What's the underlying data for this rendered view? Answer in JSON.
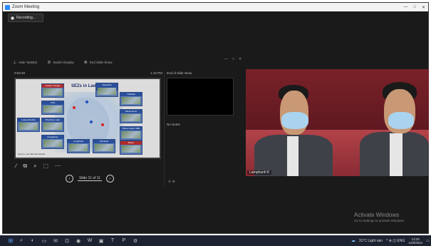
{
  "window": {
    "title": "Zoom Meeting",
    "controls": [
      "—",
      "□",
      "✕"
    ]
  },
  "recording": {
    "label": "Recording..."
  },
  "share_toolbar": {
    "items": [
      {
        "icon": "hide-taskbar-icon",
        "glyph": "⊥",
        "label": "Hide Taskbar"
      },
      {
        "icon": "switch-display-icon",
        "glyph": "⊘",
        "label": "Switch Display"
      },
      {
        "icon": "end-show-icon",
        "glyph": "⊗",
        "label": "End Slide Show"
      }
    ],
    "panel_controls": [
      "—",
      "□",
      "✕"
    ]
  },
  "viewer": {
    "time": "0:53:29",
    "slide_count": "1:10 PM"
  },
  "slide": {
    "title": "SEZs in Lao PDR",
    "boxes": [
      {
        "label": "Golden Triangle",
        "color": "red"
      },
      {
        "label": "Saysettha Development",
        "color": "blue"
      },
      {
        "label": "VITA",
        "color": "blue"
      },
      {
        "label": "Thakhek",
        "color": "blue"
      },
      {
        "label": "Phoukhyo Lake",
        "color": "blue"
      },
      {
        "label": "Dongphosy",
        "color": "blue"
      },
      {
        "label": "Savan-Seno",
        "color": "blue"
      },
      {
        "label": "Longthanh",
        "color": "blue"
      },
      {
        "label": "Vientiane",
        "color": "blue"
      },
      {
        "label": "Pakse-Japan SME",
        "color": "blue"
      },
      {
        "label": "Boten",
        "color": "red"
      },
      {
        "label": "Luang Namtha",
        "color": "blue"
      }
    ],
    "footer": "Source: Lao SEZ Secretariat"
  },
  "slide_tools": [
    {
      "icon": "pen-icon",
      "glyph": "∕"
    },
    {
      "icon": "slides-icon",
      "glyph": "⧉"
    },
    {
      "icon": "magnifier-icon",
      "glyph": "⌕"
    },
    {
      "icon": "subtitles-icon",
      "glyph": "⬚"
    },
    {
      "icon": "more-options-icon",
      "glyph": "⋯"
    }
  ],
  "pager": {
    "label": "Slide 11 of 11",
    "prev_glyph": "‹",
    "next_glyph": "›"
  },
  "notes": {
    "header": "End of slide show",
    "text": "No Notes",
    "zoom_glyph": "⊖ ⊕"
  },
  "video": {
    "participant_name": "Lamphanh K"
  },
  "watermark": {
    "title": "Activate Windows",
    "subtitle": "Go to Settings to activate Windows."
  },
  "taskbar": {
    "start_glyph": "⊞",
    "apps": [
      {
        "icon": "search-icon",
        "glyph": "⌕"
      },
      {
        "icon": "edge-icon",
        "glyph": "◐"
      },
      {
        "icon": "file-explorer-icon",
        "glyph": "▭"
      },
      {
        "icon": "mail-icon",
        "glyph": "✉"
      },
      {
        "icon": "store-icon",
        "glyph": "⊡"
      },
      {
        "icon": "chrome-icon",
        "glyph": "◉"
      },
      {
        "icon": "word-icon",
        "glyph": "W"
      },
      {
        "icon": "zoom-icon",
        "glyph": "▣"
      },
      {
        "icon": "teams-icon",
        "glyph": "T"
      },
      {
        "icon": "powerpoint-icon",
        "glyph": "P"
      },
      {
        "icon": "settings-icon",
        "glyph": "⚙"
      }
    ],
    "weather": "31°C Light rain",
    "tray_glyphs": "^ ⊕ ◫ ENG",
    "time": "13:20",
    "date": "12/8/2021"
  }
}
